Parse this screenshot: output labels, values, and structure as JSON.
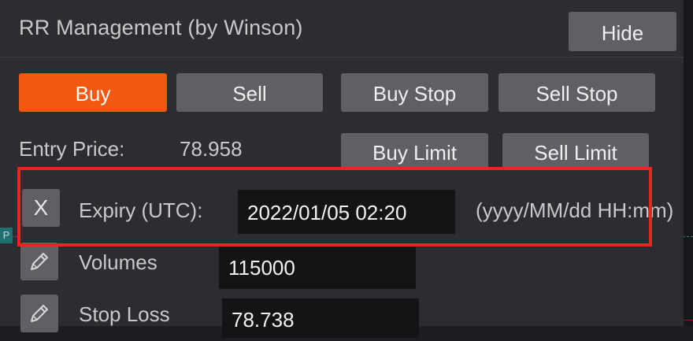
{
  "panel": {
    "title": "RR Management (by Winson)",
    "hide_label": "Hide"
  },
  "order_types": {
    "buy": "Buy",
    "sell": "Sell",
    "buy_stop": "Buy Stop",
    "sell_stop": "Sell Stop",
    "buy_limit": "Buy Limit",
    "sell_limit": "Sell Limit",
    "active": "Buy"
  },
  "entry": {
    "label": "Entry Price:",
    "value": "78.958"
  },
  "expiry": {
    "toggle_label": "X",
    "label": "Expiry (UTC):",
    "value": "2022/01/05 02:20",
    "format_hint": "(yyyy/MM/dd HH:mm)"
  },
  "volumes": {
    "label": "Volumes",
    "value": "115000",
    "icon": "pencil-icon"
  },
  "stop_loss": {
    "label": "Stop Loss",
    "value": "78.738",
    "icon": "pencil-icon"
  },
  "chart": {
    "left_marker_label": "P"
  },
  "colors": {
    "accent": "#f2580f",
    "highlight": "#e8261e",
    "panel_bg": "#2b2d31",
    "button_bg": "#5e6064",
    "field_bg": "#131416"
  }
}
